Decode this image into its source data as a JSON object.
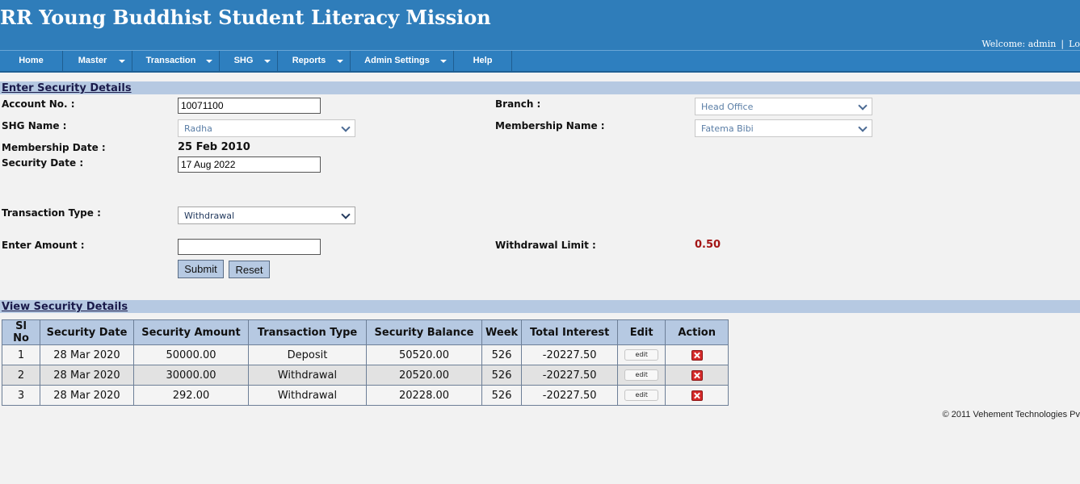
{
  "header": {
    "title": "RR Young Buddhist Student Literacy Mission",
    "welcome": "Welcome: admin",
    "separator": "|",
    "logout": "Lo"
  },
  "nav": {
    "items": [
      {
        "label": "Home"
      },
      {
        "label": "Master"
      },
      {
        "label": "Transaction"
      },
      {
        "label": "SHG"
      },
      {
        "label": "Reports"
      },
      {
        "label": "Admin Settings"
      },
      {
        "label": "Help"
      }
    ]
  },
  "form": {
    "section_title": "Enter Security Details",
    "account_no_label": "Account No. :",
    "account_no_value": "10071100",
    "branch_label": "Branch :",
    "branch_value": "Head Office",
    "shg_name_label": "SHG Name :",
    "shg_name_value": "Radha",
    "membership_name_label": "Membership Name :",
    "membership_name_value": "Fatema Bibi",
    "membership_date_label": "Membership Date :",
    "membership_date_value": "25 Feb 2010",
    "security_date_label": "Security Date :",
    "security_date_value": "17 Aug 2022",
    "transaction_type_label": "Transaction Type :",
    "transaction_type_value": "Withdrawal",
    "enter_amount_label": "Enter Amount :",
    "enter_amount_value": "",
    "withdrawal_limit_label": "Withdrawal Limit :",
    "withdrawal_limit_value": "0.50",
    "submit_label": "Submit",
    "reset_label": "Reset"
  },
  "view": {
    "section_title": "View Security Details",
    "columns": [
      "Sl No",
      "Security Date",
      "Security Amount",
      "Transaction Type",
      "Security Balance",
      "Week",
      "Total Interest",
      "Edit",
      "Action"
    ],
    "edit_label": "edit",
    "rows": [
      {
        "sl": "1",
        "date": "28 Mar 2020",
        "amount": "50000.00",
        "type": "Deposit",
        "balance": "50520.00",
        "week": "526",
        "interest": "-20227.50"
      },
      {
        "sl": "2",
        "date": "28 Mar 2020",
        "amount": "30000.00",
        "type": "Withdrawal",
        "balance": "20520.00",
        "week": "526",
        "interest": "-20227.50"
      },
      {
        "sl": "3",
        "date": "28 Mar 2020",
        "amount": "292.00",
        "type": "Withdrawal",
        "balance": "20228.00",
        "week": "526",
        "interest": "-20227.50"
      }
    ]
  },
  "footer": {
    "copyright": "© 2011 Vehement Technologies Pv"
  },
  "colors": {
    "header_bg": "#2f7dba",
    "section_bar": "#b6c9e2",
    "limit_value": "#a31515"
  },
  "icons": {
    "dropdown": "chevron-down-icon",
    "delete": "delete-icon"
  }
}
